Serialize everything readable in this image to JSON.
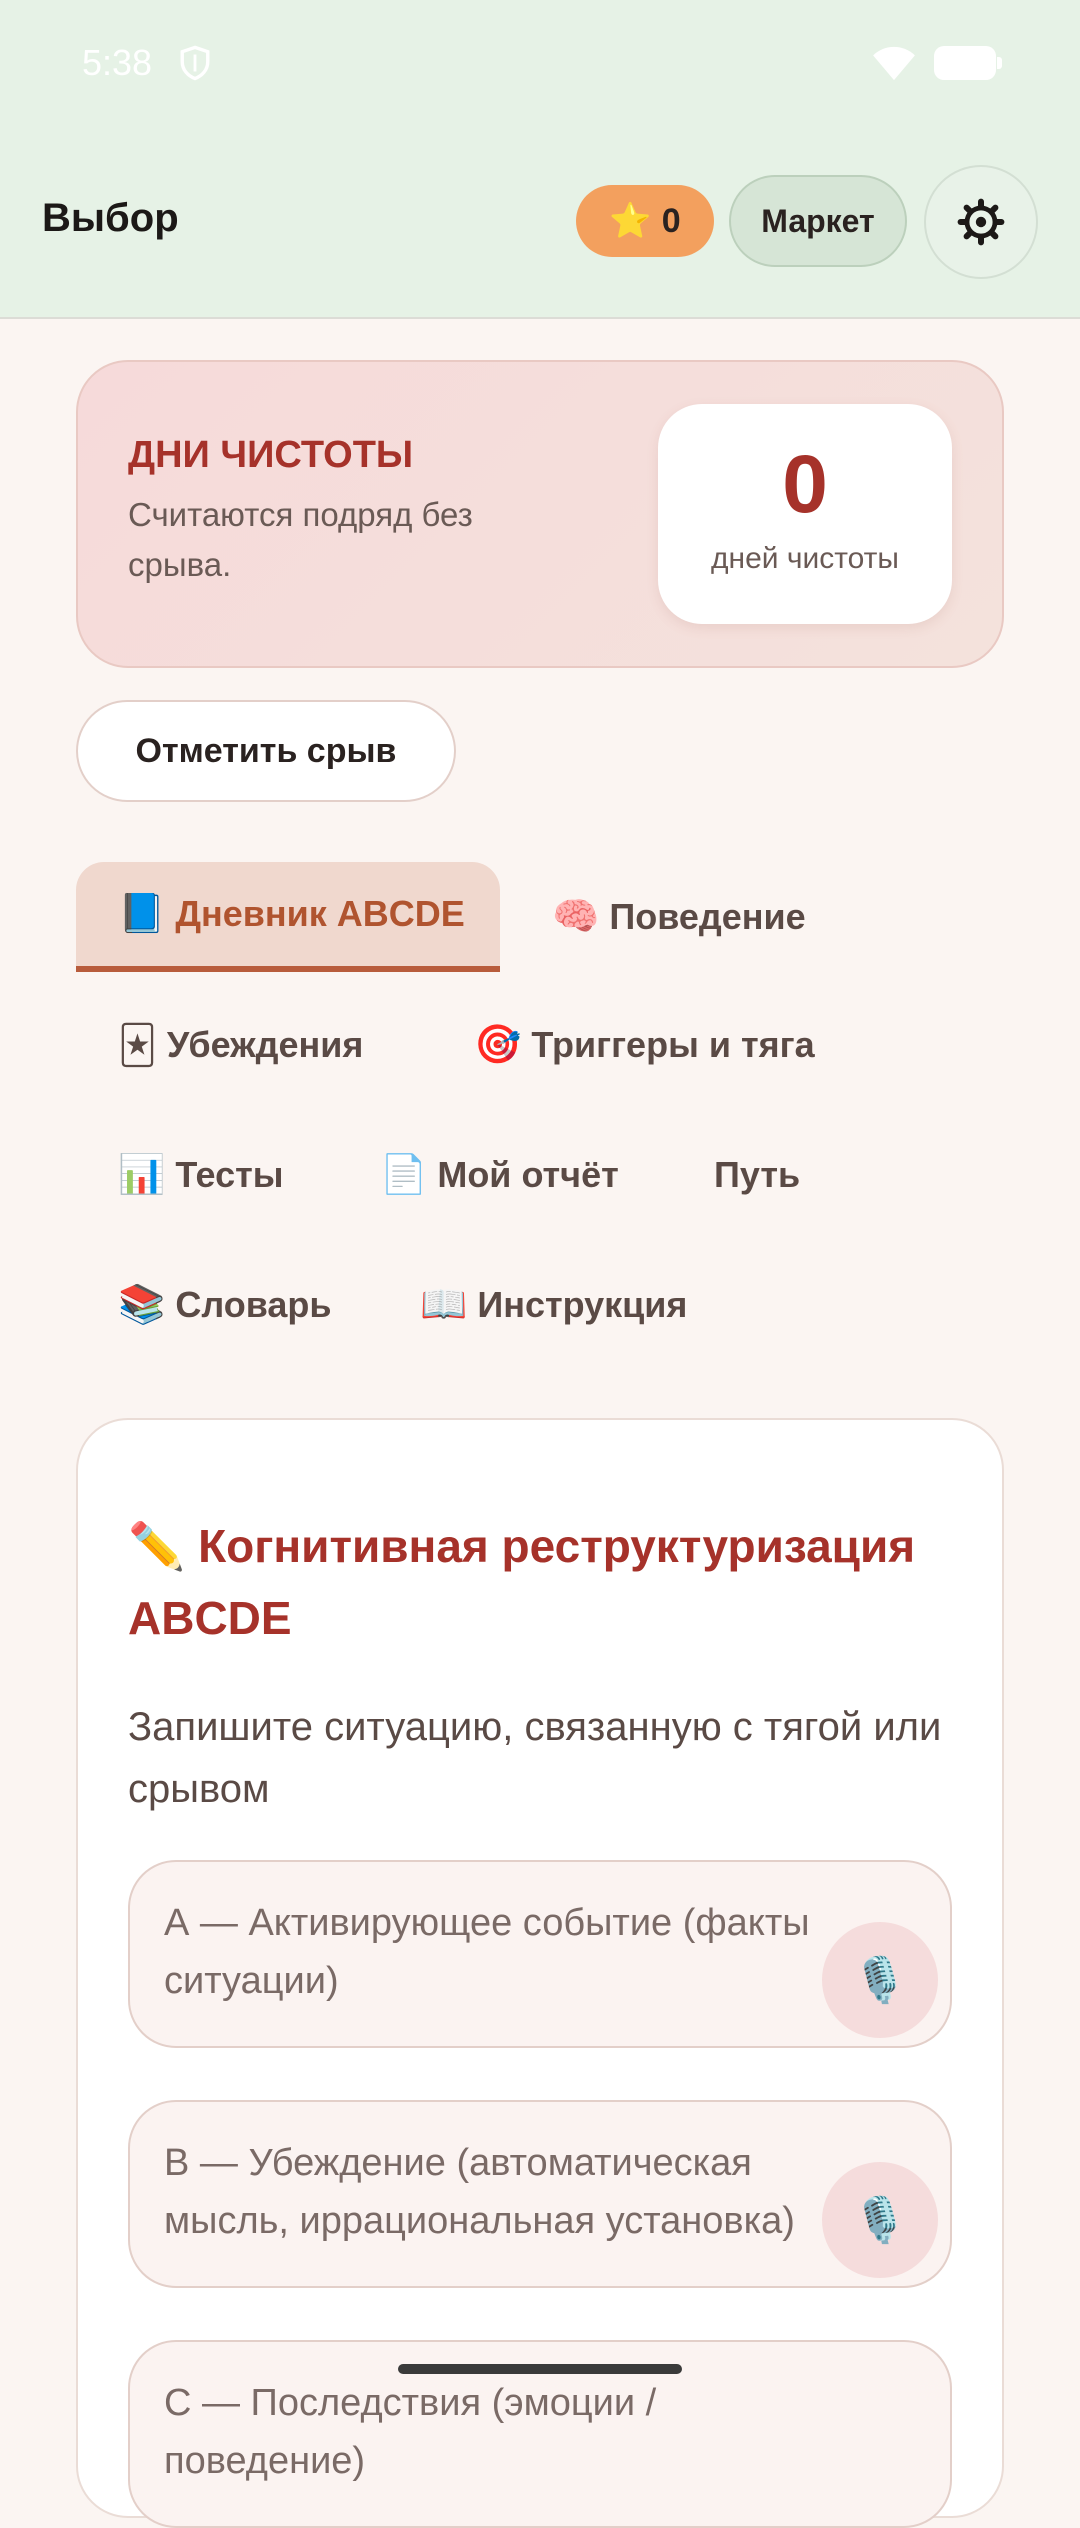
{
  "status_bar": {
    "time": "5:38"
  },
  "header": {
    "title": "Выбор",
    "stars_icon": "⭐",
    "stars_count": "0",
    "market_label": "Маркет",
    "settings_icon": "gear-icon"
  },
  "streak": {
    "heading": "ДНИ ЧИСТОТЫ",
    "description": "Считаются подряд без срыва.",
    "count": "0",
    "unit": "дней чистоты"
  },
  "relapse_button": "Отметить срыв",
  "tabs": [
    {
      "emoji": "📘",
      "label": "Дневник ABCDE",
      "active": true
    },
    {
      "emoji": "🧠",
      "label": "Поведение"
    },
    {
      "emoji": "🃏",
      "label": "Убеждения"
    },
    {
      "emoji": "🎯",
      "label": "Триггеры и тяга"
    },
    {
      "emoji": "📊",
      "label": "Тесты"
    },
    {
      "emoji": "📄",
      "label": "Мой отчёт"
    },
    {
      "emoji": "",
      "label": "Путь"
    },
    {
      "emoji": "📚",
      "label": "Словарь"
    },
    {
      "emoji": "📖",
      "label": "Инструкция"
    }
  ],
  "diary": {
    "title_emoji": "✏️",
    "title": "Когнитивная реструктуризация ABCDE",
    "subtitle": "Запишите ситуацию, связанную с тягой или срывом",
    "fields": [
      {
        "placeholder": "А — Активирующее событие (факты ситуации)"
      },
      {
        "placeholder": "В — Убеждение (автоматическая мысль, иррациональная установка)"
      },
      {
        "placeholder": "С — Последствия (эмоции / поведение)"
      }
    ],
    "mic_icon": "🎙️"
  },
  "colors": {
    "header_bg": "#e6f2e6",
    "page_bg": "#fbf5f2",
    "accent_red": "#a6322a",
    "active_tab": "#b0542f",
    "stars_pill": "#f3a05e"
  }
}
